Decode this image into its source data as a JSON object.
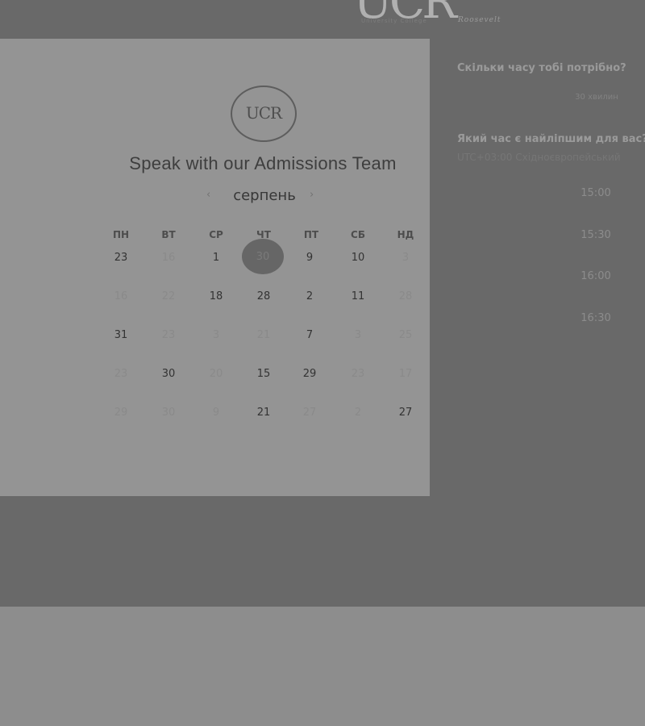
{
  "brand": {
    "logo_text": "UCR",
    "logo_sub": "Roosevelt",
    "logo_tag": "University College"
  },
  "card": {
    "badge_text": "UCR",
    "title": "Speak with our Admissions Team",
    "month": "серпень",
    "prev_icon": "chevron-left-icon",
    "next_icon": "chevron-right-icon"
  },
  "calendar": {
    "weekdays": [
      "ПН",
      "ВТ",
      "СР",
      "ЧТ",
      "ПТ",
      "СБ",
      "НД"
    ],
    "weeks": [
      [
        "23",
        "16",
        "1",
        "30",
        "9",
        "10",
        "3"
      ],
      [
        "16",
        "22",
        "18",
        "28",
        "2",
        "11",
        "28"
      ],
      [
        "31",
        "23",
        "3",
        "21",
        "7",
        "3",
        "25"
      ],
      [
        "23",
        "30",
        "20",
        "15",
        "29",
        "23",
        "17"
      ],
      [
        "29",
        "30",
        "9",
        "21",
        "27",
        "2",
        "27"
      ]
    ],
    "selected": "30"
  },
  "side": {
    "duration_question": "Скільки часу тобі потрібно?",
    "duration_value": "30 хвилин",
    "time_question": "Який час є найліпшим для вас?",
    "timezone": "UTC+03:00 Східноєвропейський",
    "slots": [
      "15:00",
      "15:30",
      "16:00",
      "16:30"
    ]
  }
}
